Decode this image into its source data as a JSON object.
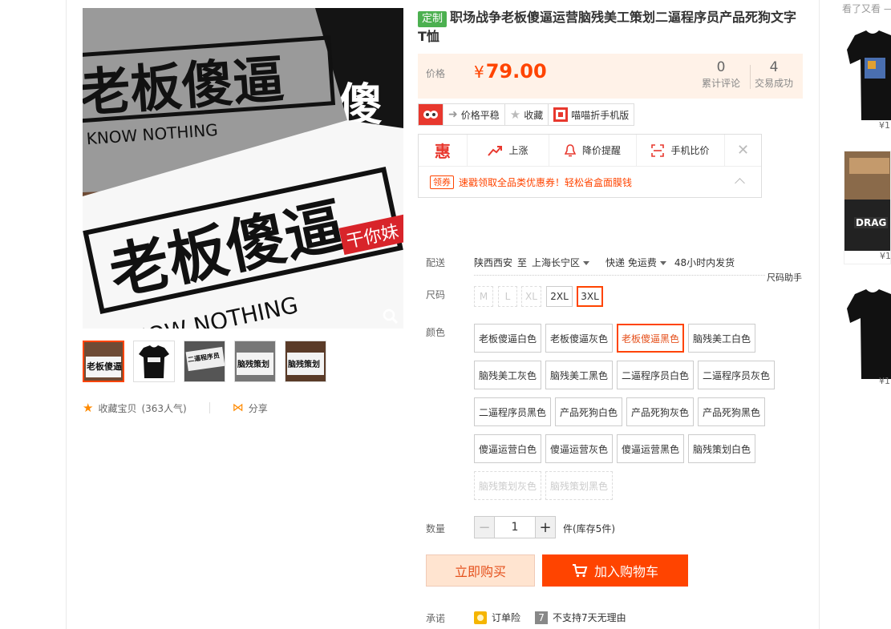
{
  "product": {
    "tag": "定制",
    "title": "职场战争老板傻逼运营脑残美工策划二逼程序员产品死狗文字T恤",
    "price_label": "价格",
    "currency": "¥",
    "price": "79.00",
    "stats": [
      {
        "value": "0",
        "label": "累计评论"
      },
      {
        "value": "4",
        "label": "交易成功"
      }
    ]
  },
  "gallery": {
    "main_text": {
      "gray_shirt": "老板傻逼",
      "gray_sub": "KNOW NOTHING",
      "black_shirt": "傻",
      "white_shirt": "老板傻逼",
      "white_sub": "KNOW NOTHING",
      "red_tag": "干你妹"
    },
    "thumbnails": [
      {
        "text": "老板傻逼",
        "selected": true
      },
      {
        "text": "",
        "selected": false
      },
      {
        "text": "二逼程序员",
        "selected": false
      },
      {
        "text": "脑残策划",
        "selected": false
      },
      {
        "text": "脑残策划",
        "selected": false
      }
    ]
  },
  "social": {
    "favorite": "收藏宝贝",
    "popularity": "(363人气)",
    "share": "分享"
  },
  "toolbar": [
    {
      "label": "价格平稳",
      "icon": "arrow-right-icon"
    },
    {
      "label": "收藏",
      "icon": "star-icon"
    },
    {
      "label": "喵喵折手机版",
      "icon": "qrcode-icon"
    }
  ],
  "assistant": {
    "logo": "惠",
    "items": [
      {
        "label": "上涨",
        "icon": "trend-up-icon"
      },
      {
        "label": "降价提醒",
        "icon": "bell-icon"
      },
      {
        "label": "手机比价",
        "icon": "scan-icon"
      }
    ],
    "coupon_tag": "领券",
    "coupon_text": "速戳领取全品类优惠券！轻松省盒面膜钱"
  },
  "shipping": {
    "label": "配送",
    "from": "陕西西安",
    "to_word": "至",
    "to": "上海长宁区",
    "method": "快递 免运费",
    "dispatch": "48小时内发货"
  },
  "sizes": {
    "label": "尺码",
    "helper": "尺码助手",
    "options": [
      {
        "label": "M",
        "state": "disabled"
      },
      {
        "label": "L",
        "state": "disabled"
      },
      {
        "label": "XL",
        "state": "disabled"
      },
      {
        "label": "2XL",
        "state": "normal"
      },
      {
        "label": "3XL",
        "state": "selected"
      }
    ]
  },
  "colors": {
    "label": "颜色",
    "options": [
      {
        "label": "老板傻逼白色",
        "state": "normal"
      },
      {
        "label": "老板傻逼灰色",
        "state": "normal"
      },
      {
        "label": "老板傻逼黑色",
        "state": "selected"
      },
      {
        "label": "脑残美工白色",
        "state": "normal"
      },
      {
        "label": "脑残美工灰色",
        "state": "normal"
      },
      {
        "label": "脑残美工黑色",
        "state": "normal"
      },
      {
        "label": "二逼程序员白色",
        "state": "normal"
      },
      {
        "label": "二逼程序员灰色",
        "state": "normal"
      },
      {
        "label": "二逼程序员黑色",
        "state": "normal"
      },
      {
        "label": "产品死狗白色",
        "state": "normal"
      },
      {
        "label": "产品死狗灰色",
        "state": "normal"
      },
      {
        "label": "产品死狗黑色",
        "state": "normal"
      },
      {
        "label": "傻逼运营白色",
        "state": "normal"
      },
      {
        "label": "傻逼运营灰色",
        "state": "normal"
      },
      {
        "label": "傻逼运营黑色",
        "state": "normal"
      },
      {
        "label": "脑残策划白色",
        "state": "normal"
      },
      {
        "label": "脑残策划灰色",
        "state": "disabled"
      },
      {
        "label": "脑残策划黑色",
        "state": "disabled"
      }
    ]
  },
  "quantity": {
    "label": "数量",
    "value": "1",
    "minus": "−",
    "plus": "+",
    "stock": "件(库存5件)"
  },
  "actions": {
    "buy_now": "立即购买",
    "add_to_cart": "加入购物车"
  },
  "promise": {
    "label": "承诺",
    "items": [
      {
        "label": "订单险",
        "icon": "insurance-icon"
      },
      {
        "label": "不支持7天无理由",
        "icon": "seven-day-icon",
        "badge": "7"
      }
    ]
  },
  "sidebar": {
    "title": "看了又看 —",
    "items": [
      {
        "price": "¥1"
      },
      {
        "price": "¥1",
        "img_text": "DRAG"
      },
      {
        "price": "¥1"
      }
    ]
  },
  "colors_theme": {
    "accent": "#ff4400",
    "price_bg": "#fff2e8",
    "buy_bg": "#ffe4d0",
    "tag_green": "#4cb050"
  }
}
